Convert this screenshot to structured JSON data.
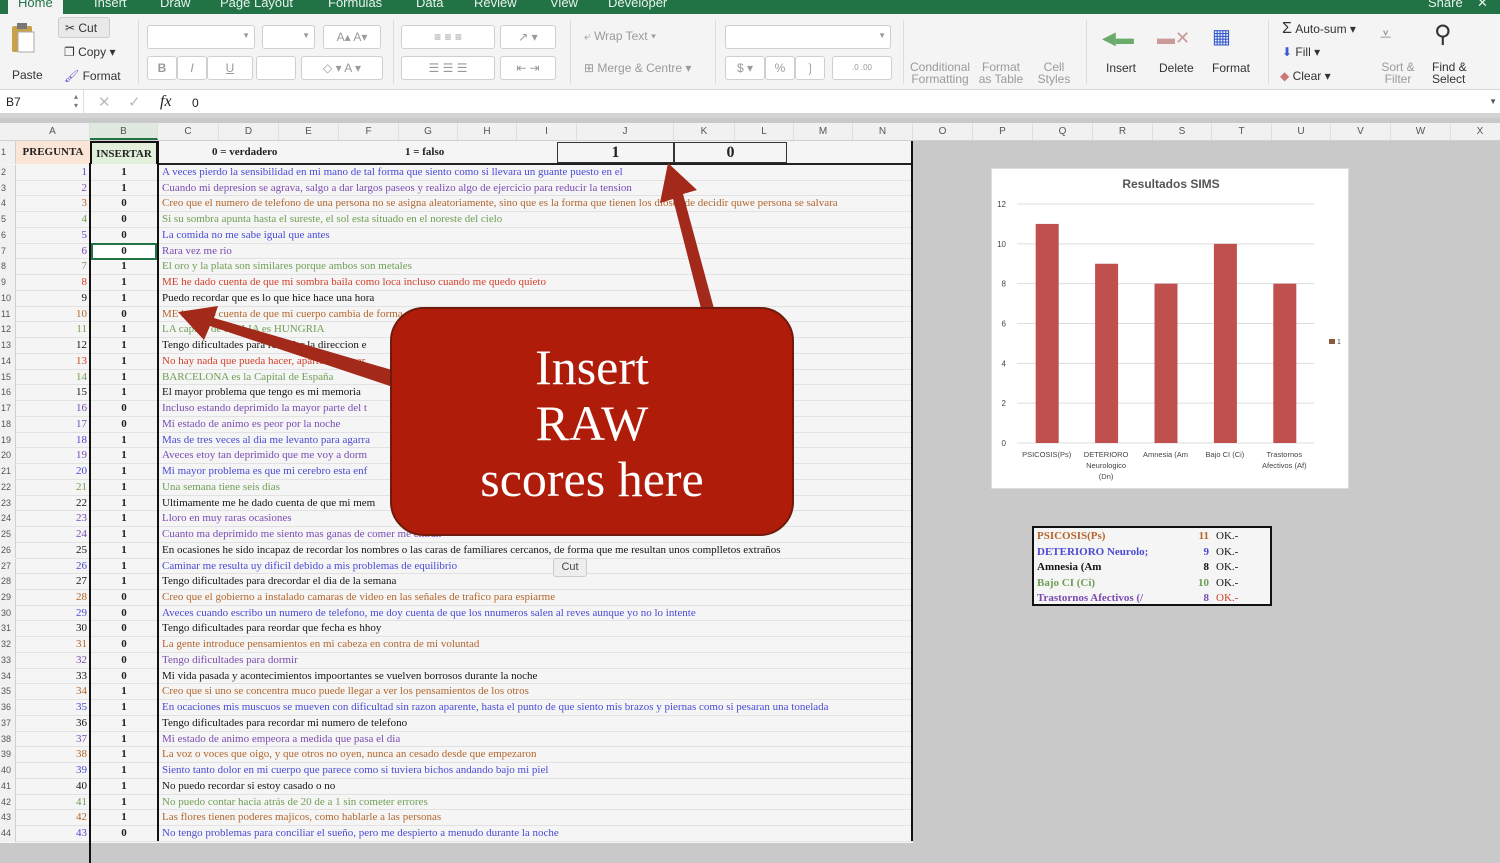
{
  "tabs": [
    "Home",
    "Insert",
    "Draw",
    "Page Layout",
    "Formulas",
    "Data",
    "Review",
    "View",
    "Developer"
  ],
  "share_label": "Share",
  "ribbon": {
    "paste": "Paste",
    "cut": "Cut",
    "copy": "Copy",
    "format_painter": "Format",
    "bold": "B",
    "italic": "I",
    "underline": "U",
    "wrap_text": "Wrap Text",
    "merge_centre": "Merge & Centre",
    "currency": "$",
    "percent": "%",
    "conditional_formatting": "Conditional Formatting",
    "format_as_table": "Format as Table",
    "cell_styles": "Cell Styles",
    "insert": "Insert",
    "delete": "Delete",
    "format": "Format",
    "autosum": "Auto-sum",
    "fill": "Fill",
    "clear": "Clear",
    "sort_filter": "Sort & Filter",
    "find_select": "Find & Select"
  },
  "formula_bar": {
    "name_box": "B7",
    "fx": "fx",
    "value": "0"
  },
  "columns": [
    "A",
    "B",
    "C",
    "D",
    "E",
    "F",
    "G",
    "H",
    "I",
    "J",
    "K",
    "L",
    "M",
    "N",
    "O",
    "P",
    "Q",
    "R",
    "S",
    "T",
    "U",
    "V",
    "W",
    "X"
  ],
  "header_row": {
    "pregunta": "PREGUNTA",
    "insertar": "INSERTAR",
    "legend_true": "0 = verdadero",
    "legend_false": "1 = falso",
    "j1": "1",
    "k1": "0"
  },
  "rows": [
    {
      "n": "1",
      "v": "1",
      "c": "blue",
      "t": "A veces pierdo la sensibilidad en mi mano de tal forma que siento como si llevara un guante puesto en el"
    },
    {
      "n": "2",
      "v": "1",
      "c": "purple",
      "t": "Cuando mi depresion se agrava, salgo a dar largos paseos y realizo algo de ejercicio para reducir la tension"
    },
    {
      "n": "3",
      "v": "0",
      "c": "orange",
      "t": "Creo que el numero de telefono de una persona no se asigna aleatoriamente, sino que es la forma que tienen los dioses de decidir quwe persona se salvara"
    },
    {
      "n": "4",
      "v": "0",
      "c": "green",
      "t": "Si su sombra apunta hasta el sureste, el sol esta situado en el noreste del cielo"
    },
    {
      "n": "5",
      "v": "0",
      "c": "blue",
      "t": "La comida no me sabe igual que antes"
    },
    {
      "n": "6",
      "v": "0",
      "c": "purple",
      "t": "Rara vez me rio"
    },
    {
      "n": "7",
      "v": "1",
      "c": "green",
      "t": "El oro y la plata son similares porque ambos son metales"
    },
    {
      "n": "8",
      "v": "1",
      "c": "red",
      "t": "ME he dado cuenta de que mi sombra baila como loca incluso cuando me quedo quieto"
    },
    {
      "n": "9",
      "v": "1",
      "c": "black",
      "t": "Puedo recordar que es lo que hice hace una hora"
    },
    {
      "n": "10",
      "v": "0",
      "c": "orange",
      "t": "ME he dado cuenta de que mi cuerpo cambia de forma"
    },
    {
      "n": "11",
      "v": "1",
      "c": "green",
      "t": "LA capital de ITALIA es HUNGRIA"
    },
    {
      "n": "12",
      "v": "1",
      "c": "black",
      "t": "Tengo dificultades para recordar la direccion e"
    },
    {
      "n": "13",
      "v": "1",
      "c": "red",
      "t": "No hay nada que pueda hacer, aparte de tomar"
    },
    {
      "n": "14",
      "v": "1",
      "c": "green",
      "t": "BARCELONA es la Capital de España"
    },
    {
      "n": "15",
      "v": "1",
      "c": "black",
      "t": "El mayor problema que tengo es mi memoria"
    },
    {
      "n": "16",
      "v": "0",
      "c": "purple",
      "t": "Incluso estando deprimido la mayor parte del t"
    },
    {
      "n": "17",
      "v": "0",
      "c": "purple",
      "t": "Mi estado de animo es peor por la noche"
    },
    {
      "n": "18",
      "v": "1",
      "c": "blue",
      "t": "Mas de tres veces al dia me levanto para agarra"
    },
    {
      "n": "19",
      "v": "1",
      "c": "purple",
      "t": "Aveces etoy tan deprimido que me voy a dorm"
    },
    {
      "n": "20",
      "v": "1",
      "c": "blue",
      "t": "Mi mayor problema es que mi cerebro esta enf"
    },
    {
      "n": "21",
      "v": "1",
      "c": "green",
      "t": "Una semana tiene seis dias"
    },
    {
      "n": "22",
      "v": "1",
      "c": "black",
      "t": "Ultimamente me he dado cuenta de que mi mem"
    },
    {
      "n": "23",
      "v": "1",
      "c": "purple",
      "t": "Lloro en muy raras ocasiones"
    },
    {
      "n": "24",
      "v": "1",
      "c": "purple",
      "t": "Cuanto ma deprimido me siento mas ganas de comer  me entran"
    },
    {
      "n": "25",
      "v": "1",
      "c": "black",
      "t": "En ocasiones he sido incapaz de recordar los nombres o las caras de familiares cercanos, de forma que me resultan unos complletos extraños"
    },
    {
      "n": "26",
      "v": "1",
      "c": "blue",
      "t": "Caminar me resulta uy dificil debido a mis problemas de equilibrio"
    },
    {
      "n": "27",
      "v": "1",
      "c": "black",
      "t": "Tengo dificultades para drecordar el dia de la semana"
    },
    {
      "n": "28",
      "v": "0",
      "c": "orange",
      "t": "Creo que el gobierno a instalado camaras de video en las señales de trafico para espiarme"
    },
    {
      "n": "29",
      "v": "0",
      "c": "blue",
      "t": "Aveces cuando escribo un numero de telefono, me doy cuenta de que los nnumeros salen al reves aunque yo no lo intente"
    },
    {
      "n": "30",
      "v": "0",
      "c": "black",
      "t": "Tengo dificultades para reordar que fecha es hhoy"
    },
    {
      "n": "31",
      "v": "0",
      "c": "orange",
      "t": "La gente introduce pensamientos en mi cabeza en contra de mi voluntad"
    },
    {
      "n": "32",
      "v": "0",
      "c": "purple",
      "t": "Tengo dificultades para dormir"
    },
    {
      "n": "33",
      "v": "0",
      "c": "black",
      "t": "Mi vida pasada y acontecimientos impoortantes se vuelven borrosos durante la noche"
    },
    {
      "n": "34",
      "v": "1",
      "c": "orange",
      "t": "Creo que si uno se concentra muco puede llegar a ver los pensamientos de los otros"
    },
    {
      "n": "35",
      "v": "1",
      "c": "blue",
      "t": "En ocaciones mis muscuos se mueven con dificultad sin razon aparente, hasta el punto de que siento mis brazos y piernas como si pesaran una tonelada"
    },
    {
      "n": "36",
      "v": "1",
      "c": "black",
      "t": "Tengo dificultades para recordar mi numero de telefono"
    },
    {
      "n": "37",
      "v": "1",
      "c": "purple",
      "t": "Mi estado de animo empeora a medida que pasa el dia"
    },
    {
      "n": "38",
      "v": "1",
      "c": "orange",
      "t": "La voz o voces que oigo, y que otros no oyen, nunca an cesado desde que empezaron"
    },
    {
      "n": "39",
      "v": "1",
      "c": "blue",
      "t": "Siento tanto dolor en mi cuerpo que parece como si tuviera bichos andando bajo mi piel"
    },
    {
      "n": "40",
      "v": "1",
      "c": "black",
      "t": "No puedo recordar si estoy casado o no"
    },
    {
      "n": "41",
      "v": "1",
      "c": "green",
      "t": "No puedo contar hacia atrás de 20 de a 1 sin cometer errores"
    },
    {
      "n": "42",
      "v": "1",
      "c": "orange",
      "t": "Las flores tienen poderes majicos, como hablarle a las personas"
    },
    {
      "n": "43",
      "v": "0",
      "c": "blue",
      "t": "No tengo problemas para conciliar el sueño, pero me despierto a menudo durante la noche"
    }
  ],
  "text_colors": {
    "blue": "#4a4ad6",
    "purple": "#7b4bb3",
    "orange": "#b4662c",
    "green": "#6f9f55",
    "red": "#d2402c",
    "black": "#151515"
  },
  "annotation": {
    "line1": "Insert",
    "line2": "RAW",
    "line3": "scores here",
    "color": "#b01c0a"
  },
  "tooltip": "Cut",
  "chart_data": {
    "type": "bar",
    "title": "Resultados SIMS",
    "categories": [
      "PSICOSIS(Ps)",
      "DETERIORO Neurologico (Dn)",
      "Amnesia (Am",
      "Bajo CI (Ci)",
      "Trastornos Afectivos (Af)"
    ],
    "values": [
      11,
      9,
      8,
      10,
      8
    ],
    "series_name": "1",
    "ylim": [
      0,
      12
    ],
    "yticks": [
      "0",
      "2",
      "4",
      "6",
      "8",
      "10",
      "12"
    ],
    "legend": "right",
    "bar_color": "#c0504d"
  },
  "summary": [
    {
      "label": "PSICOSIS(Ps)",
      "value": "11",
      "status": "OK.-",
      "c": "orange"
    },
    {
      "label": "DETERIORO Neurolo;",
      "value": "9",
      "status": "OK.-",
      "c": "blue"
    },
    {
      "label": "Amnesia (Am",
      "value": "8",
      "status": "OK.-",
      "c": "black"
    },
    {
      "label": "Bajo CI (Ci)",
      "value": "10",
      "status": "OK.-",
      "c": "green"
    },
    {
      "label": "Trastornos Afectivos (/",
      "value": "8",
      "status": "OK.-",
      "c": "purple"
    }
  ]
}
